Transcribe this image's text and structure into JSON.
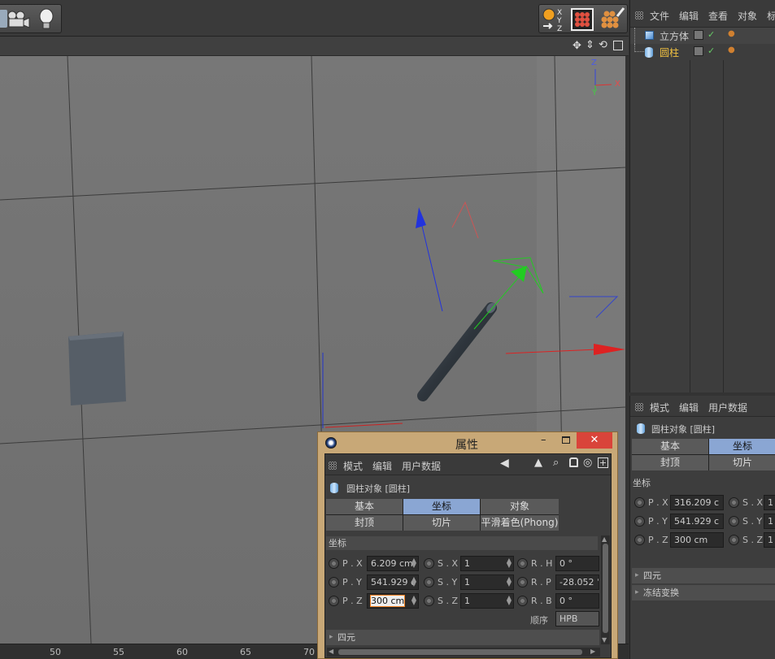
{
  "object_manager": {
    "menu": [
      "文件",
      "编辑",
      "查看",
      "对象",
      "标"
    ],
    "objects": [
      {
        "name": "立方体",
        "icon": "cube-icon"
      },
      {
        "name": "圆柱",
        "icon": "cylinder-icon"
      }
    ]
  },
  "viewport": {
    "axis_labels": {
      "z": "Z",
      "x": "X",
      "y": "Y"
    }
  },
  "timeline": {
    "ticks": [
      "50",
      "55",
      "60",
      "65",
      "70"
    ]
  },
  "attributes": {
    "menu": [
      "模式",
      "编辑",
      "用户数据"
    ],
    "object_title": "圆柱对象 [圆柱]",
    "tabs": [
      "基本",
      "坐标",
      "封顶",
      "切片"
    ],
    "active_tab": "坐标",
    "section": "坐标",
    "rows": [
      {
        "p_label": "P . X",
        "p_value": "316.209 c",
        "s_label": "S . X",
        "s_value": "1"
      },
      {
        "p_label": "P . Y",
        "p_value": "541.929 c",
        "s_label": "S . Y",
        "s_value": "1"
      },
      {
        "p_label": "P . Z",
        "p_value": "300 cm",
        "s_label": "S . Z",
        "s_value": "1"
      }
    ],
    "collapsed": [
      "四元",
      "冻结变换"
    ]
  },
  "dialog": {
    "title": "属性",
    "menu": [
      "模式",
      "编辑",
      "用户数据"
    ],
    "object_title": "圆柱对象 [圆柱]",
    "tabs": [
      "基本",
      "坐标",
      "对象",
      "封顶",
      "切片",
      "平滑着色(Phong)"
    ],
    "active_tab": "坐标",
    "section": "坐标",
    "rows": [
      {
        "p_label": "P . X",
        "p_value": "6.209 cm",
        "s_label": "S . X",
        "s_value": "1",
        "r_label": "R . H",
        "r_value": "0 °"
      },
      {
        "p_label": "P . Y",
        "p_value": "541.929 c",
        "s_label": "S . Y",
        "s_value": "1",
        "r_label": "R . P",
        "r_value": "-28.052 °"
      },
      {
        "p_label": "P . Z",
        "p_value": "300 cm",
        "s_label": "S . Z",
        "s_value": "1",
        "r_label": "R . B",
        "r_value": "0 °"
      }
    ],
    "order_label": "顺序",
    "order_value": "HPB",
    "collapsed": [
      "四元"
    ]
  },
  "colors": {
    "accent": "#8aa6d3",
    "dialog_frame": "#c8a877",
    "close_red": "#d9443a",
    "selected_name": "#f0c040"
  }
}
